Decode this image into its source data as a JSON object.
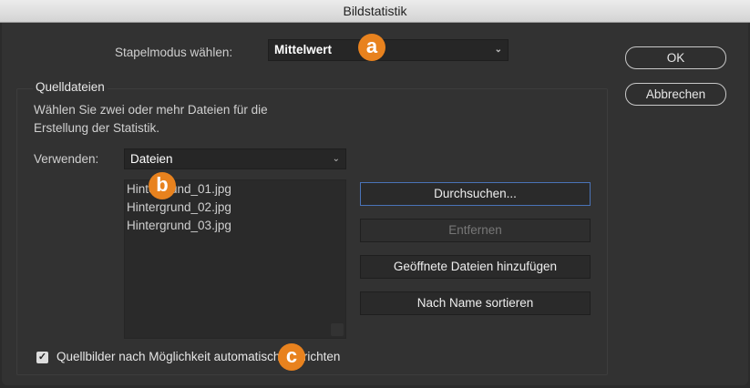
{
  "window": {
    "title": "Bildstatistik"
  },
  "stack_mode": {
    "label": "Stapelmodus wählen:",
    "value": "Mittelwert"
  },
  "buttons": {
    "ok": "OK",
    "cancel": "Abbrechen"
  },
  "source_files": {
    "group_label": "Quelldateien",
    "description_line1": "Wählen Sie zwei oder mehr Dateien für die",
    "description_line2": "Erstellung der Statistik.",
    "use_label": "Verwenden:",
    "use_value": "Dateien",
    "files": [
      "Hintergrund_01.jpg",
      "Hintergrund_02.jpg",
      "Hintergrund_03.jpg"
    ],
    "browse": "Durchsuchen...",
    "remove": "Entfernen",
    "add_open": "Geöffnete Dateien hinzufügen",
    "sort_name": "Nach Name sortieren"
  },
  "auto_align": {
    "label": "Quellbilder nach Möglichkeit automatisch ausrichten",
    "checked": true
  },
  "annotations": {
    "a": "a",
    "b": "b",
    "c": "c"
  },
  "colors": {
    "badge": "#e8821e",
    "focus": "#4a73b8"
  }
}
